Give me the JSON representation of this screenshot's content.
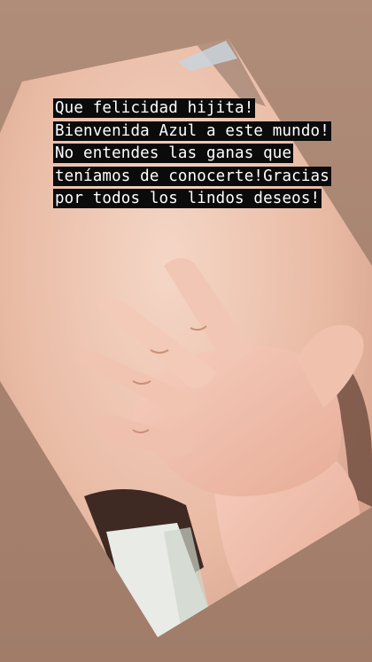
{
  "story": {
    "caption": "Que felicidad hijita! Bienvenida Azul a este mundo! No entendes las ganas que teníamos de conocerte!Gracias por todos los lindos deseos!"
  },
  "photo": {
    "subject": "baby-hand-photo",
    "colors": {
      "background": "#a98672",
      "skin": "#f0c6b3",
      "skin_shadow": "#d9a692",
      "dark": "#3e2a22",
      "cloth": "#e8ebe6"
    }
  }
}
